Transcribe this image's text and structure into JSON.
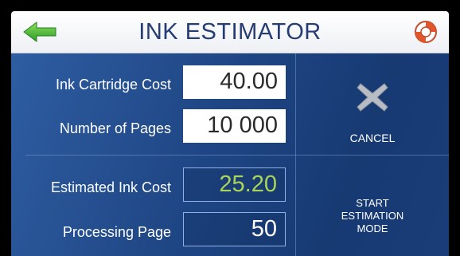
{
  "header": {
    "title": "INK ESTIMATOR",
    "back_icon": "arrow-left-icon",
    "help_icon": "lifebuoy-icon"
  },
  "form": {
    "cartridge_cost_label": "Ink Cartridge Cost",
    "cartridge_cost_value": "40.00",
    "pages_label": "Number of Pages",
    "pages_value": "10 000",
    "estimated_cost_label": "Estimated Ink Cost",
    "estimated_cost_value": "25.20",
    "processing_label": "Processing Page",
    "processing_value": "50"
  },
  "actions": {
    "cancel_label": "CANCEL",
    "cancel_icon": "close-x-icon",
    "start_line1": "START",
    "start_line2": "ESTIMATION",
    "start_line3": "MODE"
  },
  "colors": {
    "title": "#253c74",
    "panel": "#1f4684",
    "estimated_value": "#a8d458",
    "processing_value": "#ffffff"
  }
}
